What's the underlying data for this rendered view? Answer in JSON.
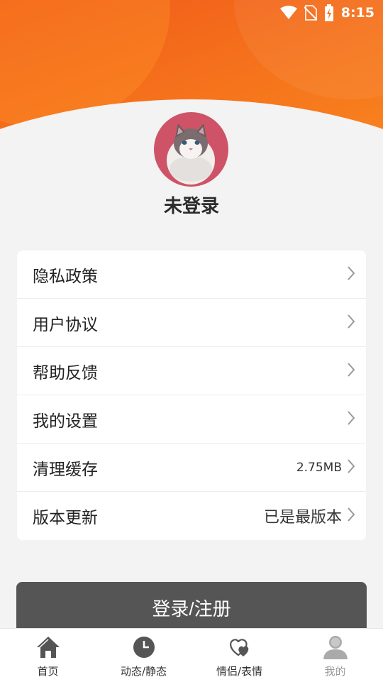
{
  "status_bar": {
    "time": "8:15",
    "icons": [
      "wifi-icon",
      "no-sim-icon",
      "battery-charging-icon"
    ]
  },
  "profile": {
    "avatar": "cat-avatar",
    "username": "未登录"
  },
  "menu": {
    "items": [
      {
        "label": "隐私政策",
        "value": ""
      },
      {
        "label": "用户协议",
        "value": ""
      },
      {
        "label": "帮助反馈",
        "value": ""
      },
      {
        "label": "我的设置",
        "value": ""
      },
      {
        "label": "清理缓存",
        "value": "2.75MB"
      },
      {
        "label": "版本更新",
        "value": "已是最版本"
      }
    ]
  },
  "login_button": {
    "label": "登录/注册"
  },
  "tabbar": {
    "tabs": [
      {
        "label": "首页",
        "icon": "home-icon"
      },
      {
        "label": "动态/静态",
        "icon": "clock-icon"
      },
      {
        "label": "情侣/表情",
        "icon": "hearts-icon"
      },
      {
        "label": "我的",
        "icon": "person-icon"
      }
    ]
  },
  "colors": {
    "accent": "#f26a1b",
    "button": "#555555",
    "background": "#f3f3f3"
  }
}
